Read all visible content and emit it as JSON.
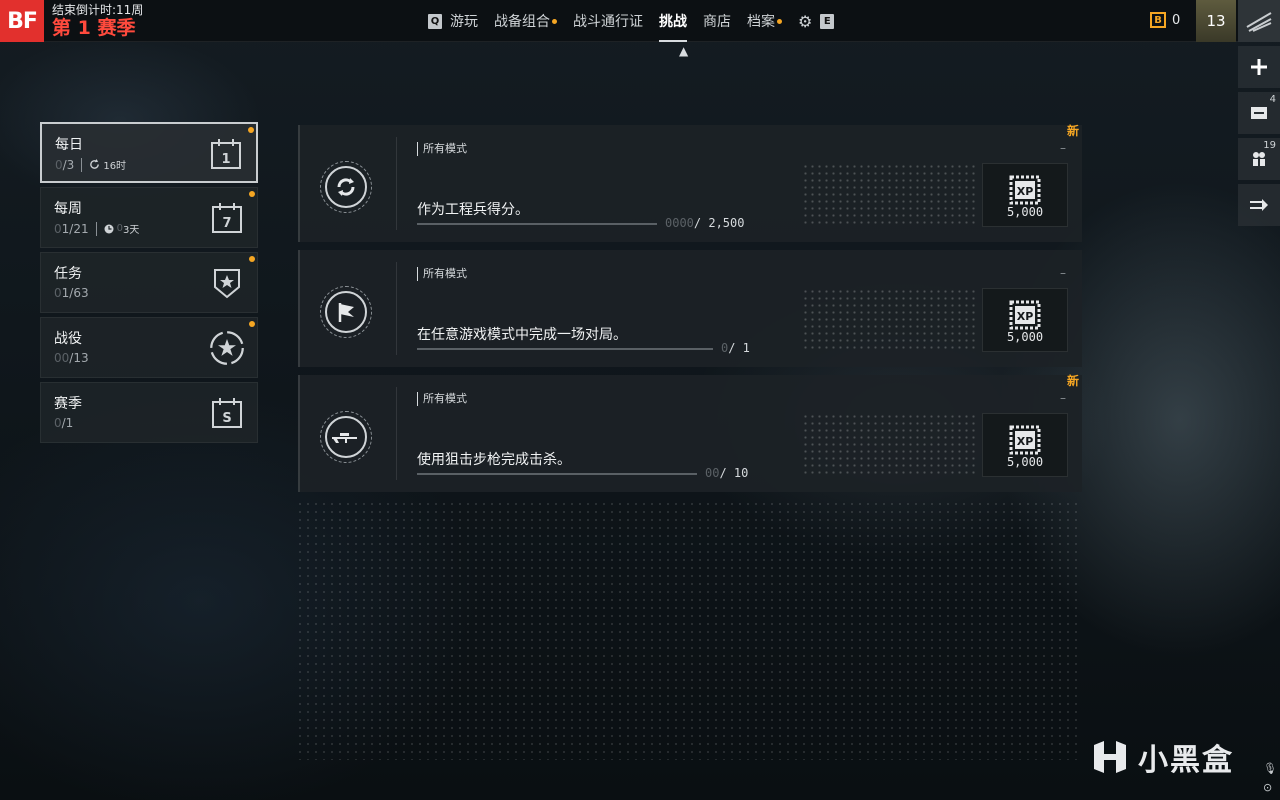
{
  "header": {
    "logo": "BF",
    "countdown": "结束倒计时:11周",
    "season": "第 1 赛季",
    "nav_left_key": "Q",
    "nav_right_key": "E",
    "nav": [
      {
        "label": "游玩",
        "dot": false,
        "active": false
      },
      {
        "label": "战备组合",
        "dot": true,
        "active": false
      },
      {
        "label": "战斗通行证",
        "dot": false,
        "active": false
      },
      {
        "label": "挑战",
        "dot": false,
        "active": true
      },
      {
        "label": "商店",
        "dot": false,
        "active": false
      },
      {
        "label": "档案",
        "dot": true,
        "active": false
      }
    ],
    "currency_icon": "B",
    "currency_value": "0",
    "level": "13"
  },
  "rail": {
    "add_icon": "plus-icon",
    "mail_count": "4",
    "squad_count": "19",
    "exit_icon": "exit-icon"
  },
  "tabs": [
    {
      "title": "每日",
      "progress_dim": "0",
      "progress": "/3",
      "timer": "16时",
      "icon_text": "1",
      "active": true
    },
    {
      "title": "每周",
      "progress_dim": "0",
      "progress": "1/21",
      "timer_dim": "0",
      "timer": "3天",
      "icon_text": "7",
      "active": false
    },
    {
      "title": "任务",
      "progress_dim": "0",
      "progress": "1/63",
      "active": false
    },
    {
      "title": "战役",
      "progress_dim": "00",
      "progress": "/13",
      "active": false
    },
    {
      "title": "赛季",
      "progress_dim": "0",
      "progress": "/1",
      "icon_text": "S",
      "active": false
    }
  ],
  "cards": [
    {
      "mode": "所有模式",
      "desc": "作为工程兵得分。",
      "progress_dim": "0000",
      "progress": "/ 2,500",
      "is_new": true,
      "new_label": "新",
      "dash": "–",
      "xp_label": "XP",
      "xp": "5,000"
    },
    {
      "mode": "所有模式",
      "desc": "在任意游戏模式中完成一场对局。",
      "progress_dim": "0",
      "progress": "/ 1",
      "is_new": false,
      "dash": "–",
      "xp_label": "XP",
      "xp": "5,000"
    },
    {
      "mode": "所有模式",
      "desc": "使用狙击步枪完成击杀。",
      "progress_dim": "00",
      "progress": "/ 10",
      "is_new": true,
      "new_label": "新",
      "dash": "–",
      "xp_label": "XP",
      "xp": "5,000"
    }
  ],
  "watermark": "小黑盒",
  "colors": {
    "accent": "#f5a623",
    "brand_red": "#e2302d",
    "season_red": "#ff4a3d"
  }
}
